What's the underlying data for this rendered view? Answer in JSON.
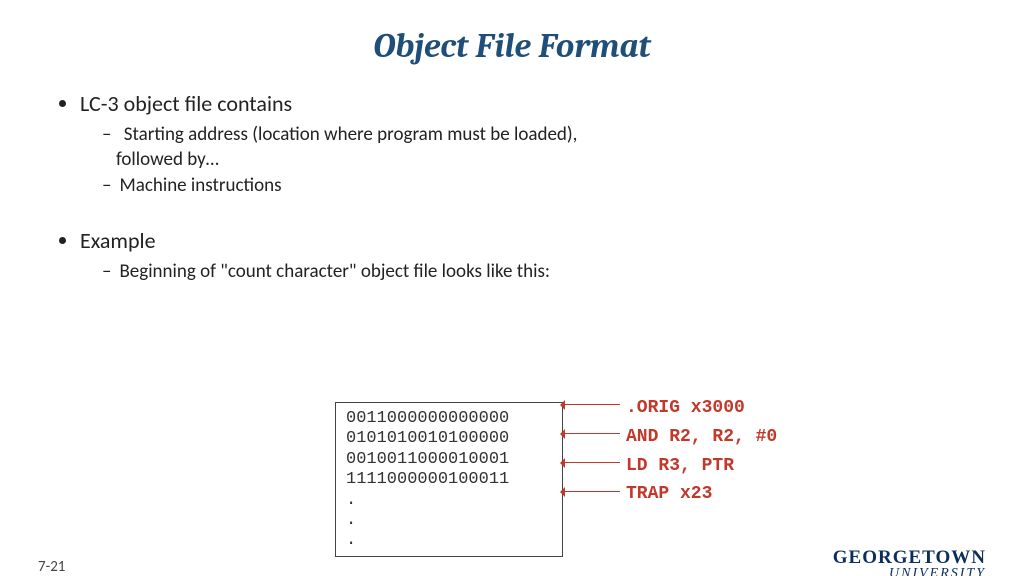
{
  "title": "Object File Format",
  "bullets": {
    "item1": {
      "label": "LC-3 object file contains",
      "sub1a": "Starting address (location where program must be loaded),",
      "sub1a_cont": "followed by…",
      "sub1b": "Machine instructions"
    },
    "item2": {
      "label": "Example",
      "sub2a": "Beginning of \"count character\" object file looks like this:"
    }
  },
  "code": {
    "l1": "0011000000000000",
    "l2": "0101010010100000",
    "l3": "0010011000010001",
    "l4": "1111000000100011",
    "l5": ".",
    "l6": ".",
    "l7": "."
  },
  "annotations": {
    "a1": ".ORIG x3000",
    "a2": "AND R2, R2, #0",
    "a3": "LD R3, PTR",
    "a4": "TRAP x23"
  },
  "page_number": "7-21",
  "logo": {
    "line1": "GEORGETOWN",
    "line2": "UNIVERSITY"
  }
}
